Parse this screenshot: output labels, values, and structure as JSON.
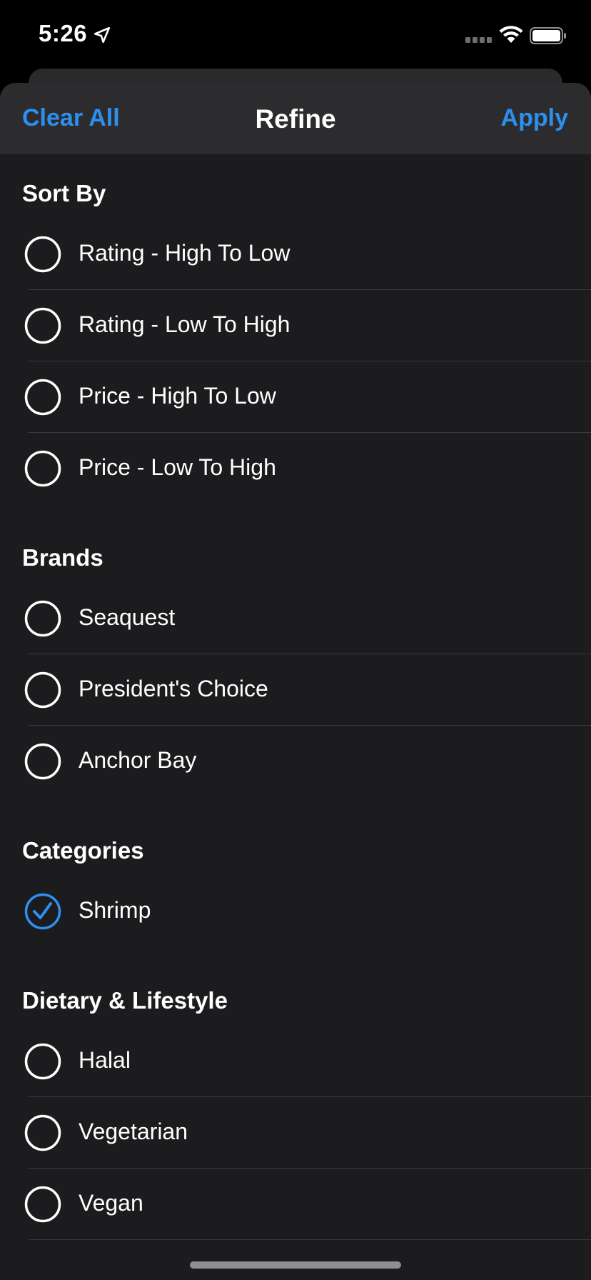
{
  "status": {
    "time": "5:26"
  },
  "nav": {
    "left_label": "Clear All",
    "title": "Refine",
    "right_label": "Apply"
  },
  "colors": {
    "accent": "#2d8ff0",
    "background": "#1c1c1e",
    "nav_background": "#2c2c2e"
  },
  "sections": [
    {
      "title": "Sort By",
      "options": [
        {
          "label": "Rating - High To Low",
          "selected": false
        },
        {
          "label": "Rating - Low To High",
          "selected": false
        },
        {
          "label": "Price - High To Low",
          "selected": false
        },
        {
          "label": "Price - Low To High",
          "selected": false
        }
      ]
    },
    {
      "title": "Brands",
      "options": [
        {
          "label": "Seaquest",
          "selected": false
        },
        {
          "label": "President's Choice",
          "selected": false
        },
        {
          "label": "Anchor Bay",
          "selected": false
        }
      ]
    },
    {
      "title": "Categories",
      "options": [
        {
          "label": "Shrimp",
          "selected": true
        }
      ]
    },
    {
      "title": "Dietary & Lifestyle",
      "options": [
        {
          "label": "Halal",
          "selected": false
        },
        {
          "label": "Vegetarian",
          "selected": false
        },
        {
          "label": "Vegan",
          "selected": false
        }
      ]
    }
  ]
}
